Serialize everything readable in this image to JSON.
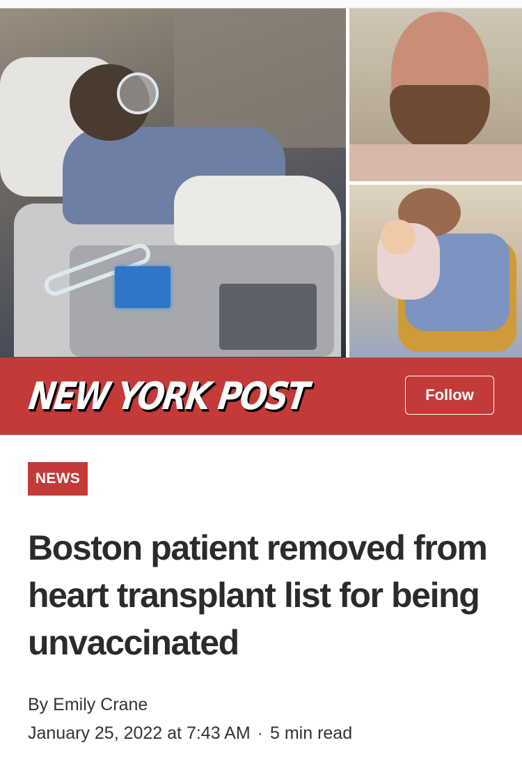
{
  "brand": {
    "logo_text": "NEW YORK POST",
    "follow_label": "Follow",
    "banner_color": "#c33a38"
  },
  "article": {
    "category": "NEWS",
    "headline": "Boston patient removed from heart transplant list for being unvaccinated",
    "byline_prefix": "By",
    "author": "Emily Crane",
    "date": "January 25, 2022 at 7:43 AM",
    "separator": "·",
    "read_time": "5 min read"
  }
}
